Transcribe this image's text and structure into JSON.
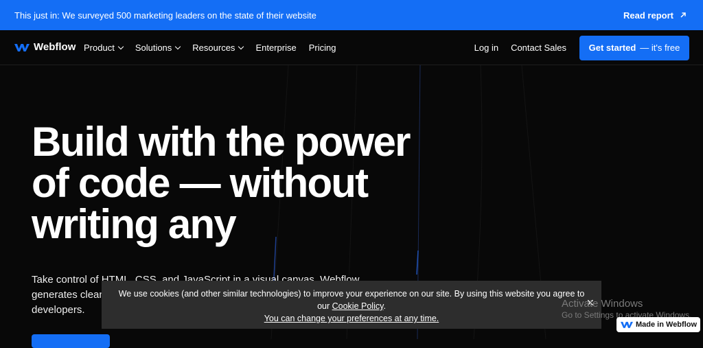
{
  "banner": {
    "text": "This just in: We surveyed 500 marketing leaders on the state of their website",
    "link_label": "Read report",
    "link_icon": "arrow-up-right-icon"
  },
  "nav": {
    "brand": "Webflow",
    "menu": [
      {
        "label": "Product",
        "dropdown": true
      },
      {
        "label": "Solutions",
        "dropdown": true
      },
      {
        "label": "Resources",
        "dropdown": true
      },
      {
        "label": "Enterprise",
        "dropdown": false
      },
      {
        "label": "Pricing",
        "dropdown": false
      }
    ],
    "login": "Log in",
    "contact": "Contact Sales",
    "cta_bold": "Get started",
    "cta_rest": "— it's free"
  },
  "hero": {
    "title_lines": [
      "Build with the power",
      "of code — without",
      "writing any"
    ],
    "subtitle_lines": [
      "Take control of HTML, CSS, and JavaScript in a visual canvas. Webflow",
      "generates clean",
      "developers."
    ]
  },
  "cookie": {
    "line1": "We use cookies (and other similar technologies) to improve your experience on our site. By using this website you agree to",
    "line2_prefix": "our ",
    "policy_link": "Cookie Policy",
    "line2_suffix": ".",
    "preferences_link": "You can change your preferences at any time.",
    "close": "✕"
  },
  "os_overlay": {
    "title": "Activate Windows",
    "subtitle": "Go to Settings to activate Windows."
  },
  "badge": {
    "label": "Made in Webflow"
  },
  "colors": {
    "brand_blue": "#146ef5",
    "background": "#080808",
    "cookie_bg": "#2d2d2d"
  }
}
